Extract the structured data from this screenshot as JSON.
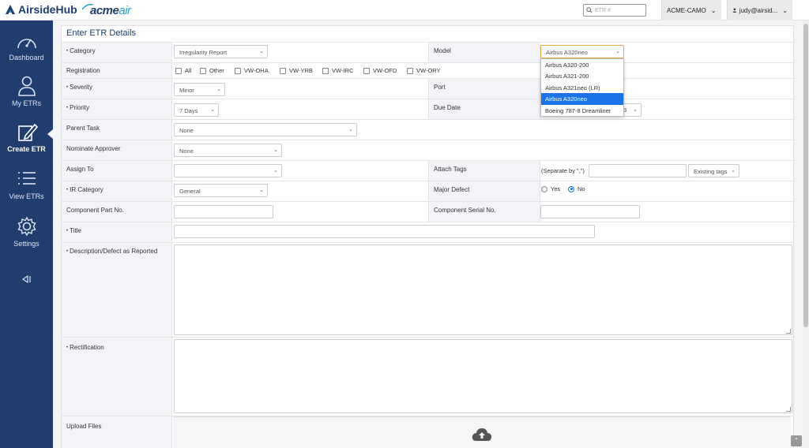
{
  "brand": {
    "name": "AirsideHub",
    "partner_a": "acme",
    "partner_b": "air"
  },
  "search": {
    "placeholder": "ETR #"
  },
  "org_button": {
    "label": "ACME-CAMO"
  },
  "user_button": {
    "label": "judy@airsid..."
  },
  "sidebar": {
    "items": [
      {
        "label": "Dashboard",
        "icon": "gauge-icon"
      },
      {
        "label": "My ETRs",
        "icon": "user-icon"
      },
      {
        "label": "Create ETR",
        "icon": "edit-icon",
        "active": true
      },
      {
        "label": "View ETRs",
        "icon": "list-icon"
      },
      {
        "label": "Settings",
        "icon": "gear-icon"
      }
    ],
    "collapse_icon": "collapse-icon"
  },
  "form": {
    "title": "Enter ETR Details",
    "category": {
      "label": "Category",
      "value": "Irregularity Report"
    },
    "model": {
      "label": "Model",
      "value": "Airbus A320neo"
    },
    "registration": {
      "label": "Registration",
      "options": [
        "All",
        "Other",
        "VW-OHA",
        "VW-YRB",
        "VW-IRC",
        "VW-OFD",
        "VW-ORY"
      ]
    },
    "severity": {
      "label": "Severity",
      "value": "Minor"
    },
    "port": {
      "label": "Port"
    },
    "priority": {
      "label": "Priority",
      "value": "7 Days"
    },
    "due_date": {
      "label": "Due Date",
      "partial_value": "3"
    },
    "parent_task": {
      "label": "Parent Task",
      "value": "None"
    },
    "nominate_approver": {
      "label": "Nominate Approver",
      "value": "None"
    },
    "assign_to": {
      "label": "Assign To",
      "value": ""
    },
    "attach_tags": {
      "label": "Attach Tags",
      "hint": "(Separate by \",\")",
      "existing_label": "Existing tags"
    },
    "ir_category": {
      "label": "IR Category",
      "value": "General"
    },
    "major_defect": {
      "label": "Major Defect",
      "yes": "Yes",
      "no": "No",
      "selected": "No"
    },
    "component_part": {
      "label": "Component Part No."
    },
    "component_serial": {
      "label": "Component Serial No."
    },
    "title_field": {
      "label": "Title"
    },
    "description": {
      "label": "Description/Defect as Reported"
    },
    "rectification": {
      "label": "Rectification"
    },
    "upload": {
      "label": "Upload Files"
    }
  },
  "model_dropdown": {
    "options": [
      "Airbus A320-200",
      "Airbus A321-200",
      "Airbus A321neo (LR)",
      "Airbus A320neo",
      "Boeing 787-8 Dreamliner"
    ],
    "selected_index": 3
  },
  "colors": {
    "sidebar": "#1f3d6d",
    "accent": "#1a73e8",
    "brand": "#1f3d6d",
    "acme_air": "#2aa3cf"
  }
}
